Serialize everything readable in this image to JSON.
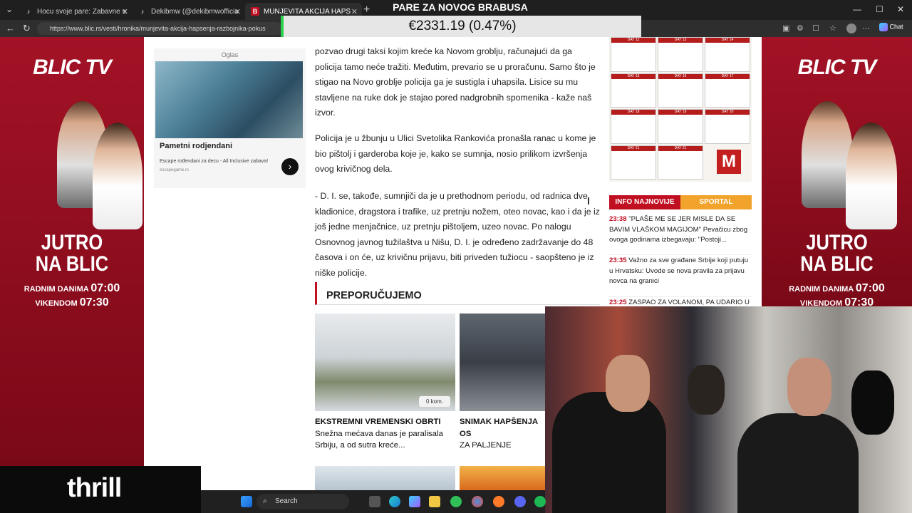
{
  "overlay": {
    "title": "PARE ZA NOVOG BRABUSA",
    "price": "€2331.19 (0.47%)"
  },
  "tabs": [
    {
      "label": "Hocu svoje pare: Zabavne situacije",
      "favicon": "TT"
    },
    {
      "label": "Dekibmw (@dekibmwofficial) | Tik",
      "favicon": "TT"
    },
    {
      "label": "MUNJEVITA AKCIJA HAPŠENJA RA",
      "favicon": "B"
    }
  ],
  "addressbar": {
    "url": "https://www.blic.rs/vesti/hronika/munjevita-akcija-hapsenja-razbojnika-pokus",
    "chat": "Chat"
  },
  "left_ad": {
    "logo": "BLIC TV",
    "line1": "JUTRO",
    "line2": "NA BLIC",
    "radnim": "RADNIM DANIMA",
    "radnim_time": "07:00",
    "vikendom": "VIKENDOM",
    "vikendom_time": "07:30"
  },
  "right_ad": {
    "logo": "BLIC TV",
    "line1": "JUTRO",
    "line2": "NA BLIC",
    "radnim": "RADNIM DANIMA",
    "radnim_time": "07:00",
    "vikendom": "VIKENDOM",
    "vikendom_time": "07:30"
  },
  "adbox": {
    "oglas": "Oglas",
    "title": "Pametni rodjendani",
    "subtitle": "Escape rođendani za decu - All Inclusive zabava!",
    "source": "escapegame.rs",
    "arrow": "›"
  },
  "article": {
    "p1": "pozvao drugi taksi kojim kreće ka Novom groblju, računajući da ga policija tamo neće tražiti. Međutim, prevario se u proračunu. Samo što je stigao na Novo groblje policija ga je sustigla i uhapsila. Lisice su mu stavljene na ruke dok je stajao pored nadgrobnih spomenika - kaže naš izvor.",
    "p2": "Policija je u žbunju u Ulici Svetolika Rankovića pronašla ranac u kome je bio pištolj i garderoba koje je, kako se sumnja, nosio prilikom izvršenja ovog krivičnog dela.",
    "p3": "- D. I. se, takođe, sumnjiči da je u prethodnom periodu, od radnica dve kladionice, dragstora i trafike, uz pretnju nožem, oteo novac, kao i da je iz još jedne menjačnice, uz pretnju pištoljem, uzeo novac. Po nalogu Osnovnog javnog tužilaštva u Nišu, D. I. je određeno zadržavanje do 48 časova i on će, uz krivičnu prijavu, biti priveden tužiocu - saopšteno je iz niške policije."
  },
  "preporucujemo": "PREPORUČUJEMO",
  "cards": [
    {
      "kicker": "EKSTREMNI VREMENSKI OBRTI",
      "text": "Snežna mećava danas je paralisala Srbiju, a od sutra kreće...",
      "comments": "0 kom."
    },
    {
      "kicker": "SNIMAK HAPŠENJA OS",
      "text": "ZA PALJENJE AUTOMO PRASETA Policajci u pu"
    }
  ],
  "exercise_days": [
    "DAY 12",
    "DAY 13",
    "DAY 14",
    "DAY 15",
    "DAY 16",
    "DAY 17",
    "DAY 18",
    "DAY 19",
    "DAY 20",
    "DAY 21",
    "DAY 21"
  ],
  "mlogo": "M",
  "info_tabs": [
    "INFO NAJNOVIJE",
    "SPORTAL"
  ],
  "news": [
    {
      "time": "23:38",
      "text": "\"PLAŠE ME SE JER MISLE DA SE BAVIM VLAŠKOM MAGIJOM\" Pevačicu zbog ovoga godinama izbegavaju: \"Postoji..."
    },
    {
      "time": "23:35",
      "text": "Važno za sve građane Srbije koji putuju u Hrvatsku: Uvode se nova pravila za prijavu novca na granici"
    },
    {
      "time": "23:25",
      "text": "ZASPAO ZA VOLANOM, PA UDARIO U"
    }
  ],
  "taskbar": {
    "search": "Search"
  },
  "thrill": "thrill",
  "colors": {
    "accent": "#c10f22",
    "sportal": "#f2a32b",
    "blic_red": "#a31226"
  }
}
